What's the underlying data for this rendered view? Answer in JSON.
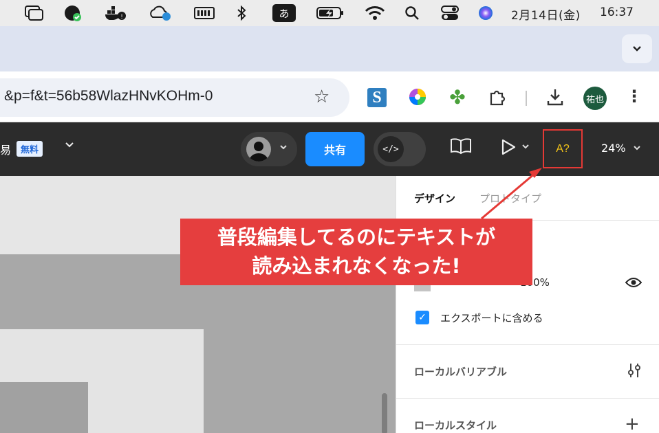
{
  "menubar": {
    "date": "2月14日(金)",
    "time": "16:37",
    "ime_label": "あ"
  },
  "tabstrip": {
    "menu_icon": "chevron-down-icon"
  },
  "toolbar": {
    "url": "&p=f&t=56b58WlazHNvKOHm-0",
    "profile_label": "祐也",
    "profile_color": "#1d5b3e"
  },
  "figma_header": {
    "file_name_partial": "易",
    "plan_badge": "無料",
    "share_label": "共有",
    "code_label": "</>",
    "font_button_label": "A?",
    "zoom_label": "24%"
  },
  "panel": {
    "tabs": [
      {
        "label": "デザイン",
        "active": true
      },
      {
        "label": "プロトタイプ",
        "active": false
      }
    ],
    "fill_opacity": "100%",
    "export_label": "エクスポートに含める",
    "export_checked": true,
    "local_variables_label": "ローカルバリアブル",
    "local_styles_label": "ローカルスタイル"
  },
  "annotation": {
    "line1": "普段編集してるのにテキストが",
    "line2": "読み込まれなくなった!",
    "color": "#e53e3e"
  },
  "colors": {
    "accent": "#1a8cff",
    "figma_bar": "#2c2c2c",
    "highlight_border": "#e53935"
  }
}
